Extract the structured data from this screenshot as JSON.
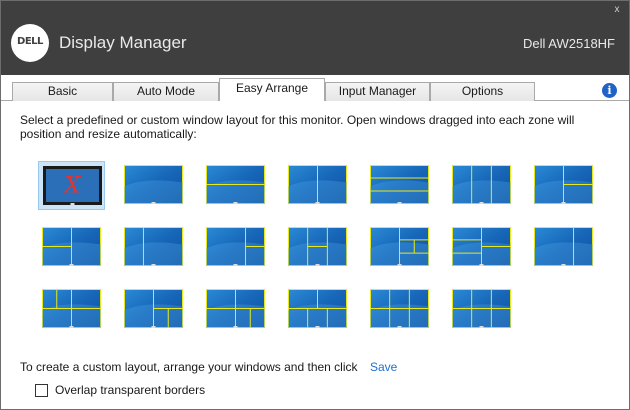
{
  "window": {
    "app_title": "Display Manager",
    "logo_text": "DELL",
    "monitor_name": "Dell AW2518HF",
    "close_glyph": "x"
  },
  "tabs": [
    {
      "label": "Basic",
      "active": false
    },
    {
      "label": "Auto Mode",
      "active": false
    },
    {
      "label": "Easy Arrange",
      "active": true
    },
    {
      "label": "Input Manager",
      "active": false
    },
    {
      "label": "Options",
      "active": false
    }
  ],
  "info_icon": {
    "name": "info-icon",
    "glyph": "i"
  },
  "easy_arrange": {
    "description": "Select a predefined or custom window layout for this monitor.  Open windows dragged into each zone will position and resize automatically:",
    "selected_layout": "none",
    "layouts": [
      {
        "id": "none",
        "selected": true
      },
      {
        "id": "full"
      },
      {
        "id": "top-bottom"
      },
      {
        "id": "left-right"
      },
      {
        "id": "three-rows"
      },
      {
        "id": "three-columns"
      },
      {
        "id": "left-plus-two-right"
      },
      {
        "id": "two-left-plus-right"
      },
      {
        "id": "narrow-left-wide-right"
      },
      {
        "id": "wide-left-split-right"
      },
      {
        "id": "three-columns-split-middle"
      },
      {
        "id": "wide-left-four-right"
      },
      {
        "id": "grid-2x3-left"
      },
      {
        "id": "wide-left-narrow-right"
      },
      {
        "id": "quad-split-left"
      },
      {
        "id": "quad-split-right"
      },
      {
        "id": "left-full-split-right"
      },
      {
        "id": "top-two-bottom-three"
      },
      {
        "id": "top-three-bottom-three"
      },
      {
        "id": "grid-2x3"
      }
    ],
    "custom_text": "To create a custom layout, arrange your windows and then click",
    "save_label": "Save",
    "overlap_label": "Overlap transparent borders",
    "overlap_checked": false
  },
  "colors": {
    "titlebar": "#3f3f3f",
    "zone_line": "#e8e81a",
    "link": "#1e6fd0",
    "selection": "#cce4f7",
    "none_x": "#e8322e"
  }
}
